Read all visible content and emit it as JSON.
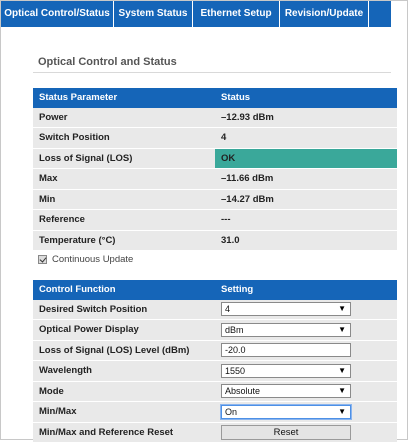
{
  "tabs": [
    {
      "label": "Optical Control/Status"
    },
    {
      "label": "System Status"
    },
    {
      "label": "Ethernet Setup"
    },
    {
      "label": "Revision/Update"
    },
    {
      "label": ""
    }
  ],
  "section_title": "Optical Control and Status",
  "status_table": {
    "headers": [
      "Status Parameter",
      "Status"
    ],
    "rows": [
      {
        "param": "Power",
        "value": "–12.93 dBm"
      },
      {
        "param": "Switch Position",
        "value": "4"
      },
      {
        "param": "Loss of Signal (LOS)",
        "value": "OK"
      },
      {
        "param": "Max",
        "value": "–11.66 dBm"
      },
      {
        "param": "Min",
        "value": "–14.27 dBm"
      },
      {
        "param": "Reference",
        "value": "---"
      },
      {
        "param": "Temperature (°C)",
        "value": "31.0"
      }
    ]
  },
  "continuous_update": {
    "label": "Continuous Update",
    "checked": true
  },
  "control_table": {
    "headers": [
      "Control Function",
      "Setting"
    ],
    "rows": [
      {
        "label": "Desired Switch Position",
        "type": "select",
        "value": "4"
      },
      {
        "label": "Optical Power Display",
        "type": "select",
        "value": "dBm"
      },
      {
        "label": "Loss of Signal (LOS) Level (dBm)",
        "type": "input",
        "value": "-20.0"
      },
      {
        "label": "Wavelength",
        "type": "select",
        "value": "1550"
      },
      {
        "label": "Mode",
        "type": "select",
        "value": "Absolute"
      },
      {
        "label": "Min/Max",
        "type": "select",
        "value": "On"
      },
      {
        "label": "Min/Max and Reference Reset",
        "type": "button",
        "value": "Reset"
      }
    ]
  },
  "colors": {
    "header_blue": "#1565b8",
    "ok_teal": "#3aa89a",
    "row_gray": "#e9e9e9"
  }
}
